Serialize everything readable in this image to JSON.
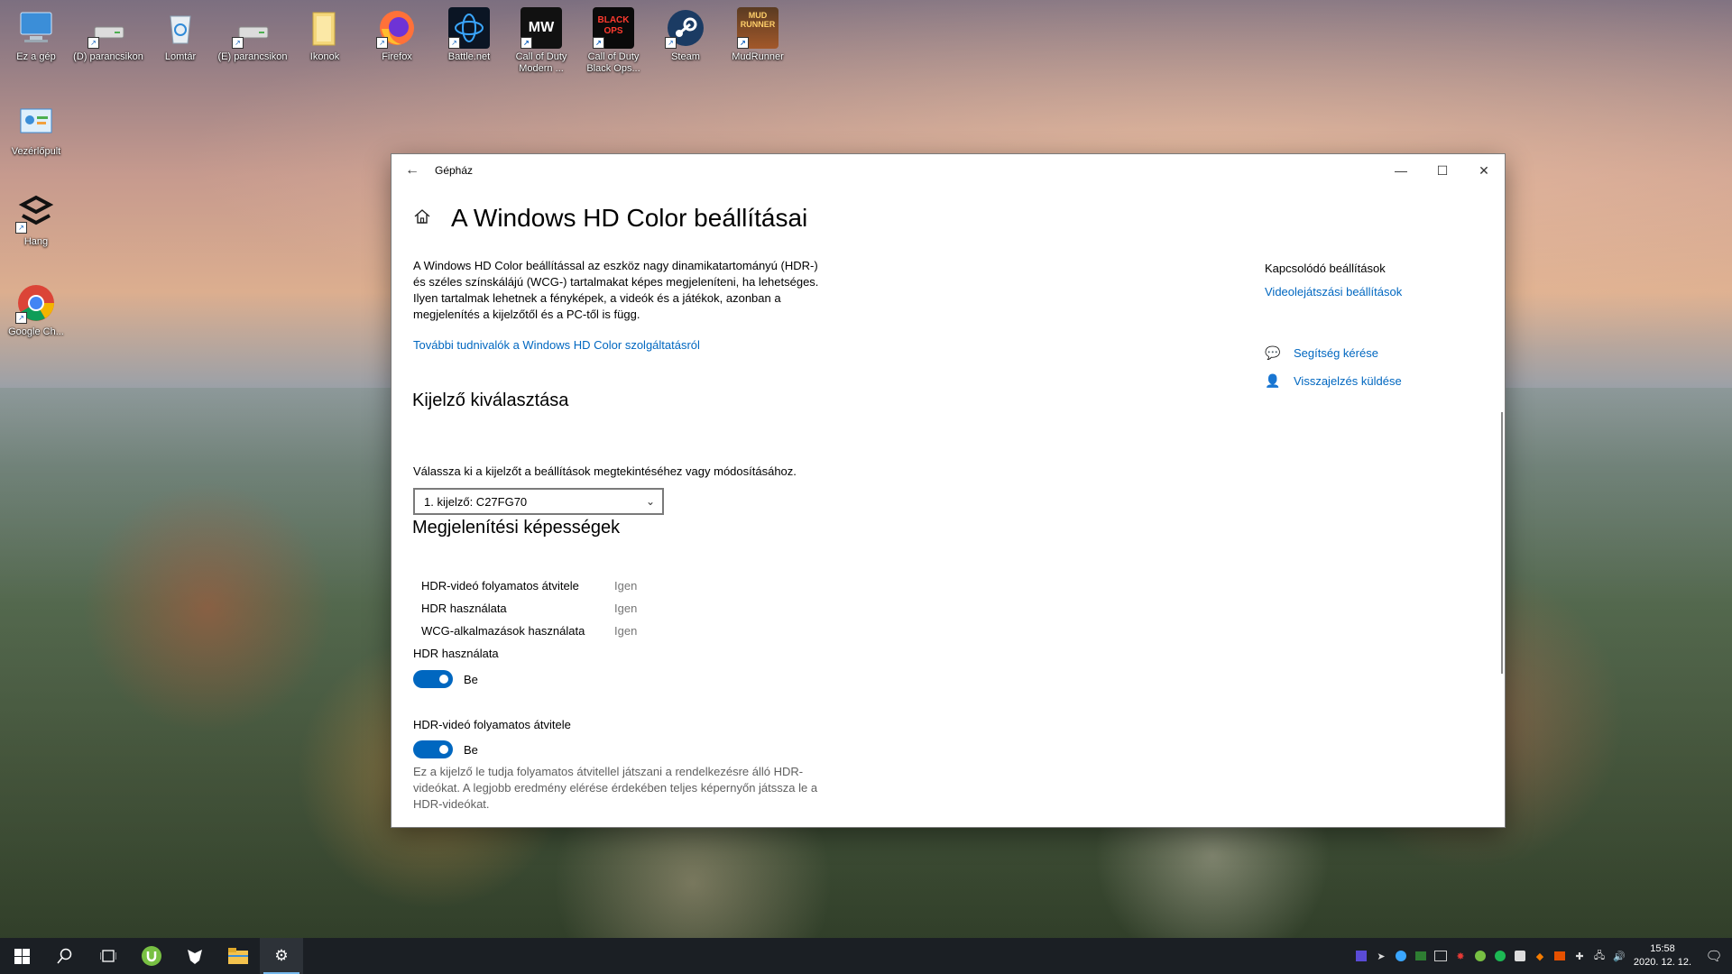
{
  "desktop": {
    "icons": [
      {
        "label": "Ez a gép",
        "icon": "computer-icon"
      },
      {
        "label": "(D) parancsikon",
        "icon": "drive-icon"
      },
      {
        "label": "Lomtár",
        "icon": "recycle-bin-icon"
      },
      {
        "label": "(E) parancsikon",
        "icon": "drive-icon"
      },
      {
        "label": "Ikonok",
        "icon": "folder-icon"
      },
      {
        "label": "Firefox",
        "icon": "firefox-icon"
      },
      {
        "label": "Battle.net",
        "icon": "battlenet-icon"
      },
      {
        "label": "Call of Duty Modern ...",
        "icon": "cod-mw-icon"
      },
      {
        "label": "Call of Duty Black Ops...",
        "icon": "cod-bo-icon"
      },
      {
        "label": "Steam",
        "icon": "steam-icon"
      },
      {
        "label": "MudRunner",
        "icon": "mudrunner-icon"
      },
      {
        "label": "Vezérlőpult",
        "icon": "control-panel-icon"
      },
      {
        "label": "Hang",
        "icon": "sound-app-icon"
      },
      {
        "label": "Google Ch...",
        "icon": "chrome-icon"
      }
    ],
    "game_icon_text": {
      "mw": "MW",
      "bo": "BLACK OPS",
      "mud": "MUD RUNNER"
    }
  },
  "window": {
    "app_title": "Gépház",
    "page_title": "A Windows HD Color beállításai",
    "description": "A Windows HD Color beállítással az eszköz nagy dinamikatartományú (HDR-) és széles színskálájú (WCG-) tartalmakat képes megjeleníteni, ha lehetséges. Ilyen tartalmak lehetnek a fényképek, a videók és a játékok, azonban a megjelenítés a kijelzőtől és a PC-től is függ.",
    "more_link": "További tudnivalók a Windows HD Color szolgáltatásról",
    "display_section": {
      "heading": "Kijelző kiválasztása",
      "instruction": "Válassza ki a kijelzőt a beállítások megtekintéséhez vagy módosításához.",
      "selected": "1. kijelző: C27FG70"
    },
    "capabilities": {
      "heading": "Megjelenítési képességek",
      "rows": [
        {
          "name": "HDR-videó folyamatos átvitele",
          "value": "Igen"
        },
        {
          "name": "HDR használata",
          "value": "Igen"
        },
        {
          "name": "WCG-alkalmazások használata",
          "value": "Igen"
        }
      ]
    },
    "hdr_toggle": {
      "label": "HDR használata",
      "state": "Be"
    },
    "stream_toggle": {
      "label": "HDR-videó folyamatos átvitele",
      "state": "Be"
    },
    "stream_note": "Ez a kijelző le tudja folyamatos átvitellel játszani a rendelkezésre álló HDR-videókat. A legjobb eredmény elérése érdekében teljes képernyőn játssza le a HDR-videókat.",
    "related": {
      "title": "Kapcsolódó beállítások",
      "link": "Videolejátszási beállítások",
      "help": "Segítség kérése",
      "feedback": "Visszajelzés küldése"
    },
    "accent_color": "#0067c0"
  },
  "taskbar": {
    "time": "15:58",
    "date": "2020. 12. 12.",
    "apps": [
      "start-icon",
      "search-icon",
      "task-view-icon",
      "utorrent-icon",
      "vpn-icon",
      "file-explorer-icon",
      "settings-icon"
    ]
  }
}
